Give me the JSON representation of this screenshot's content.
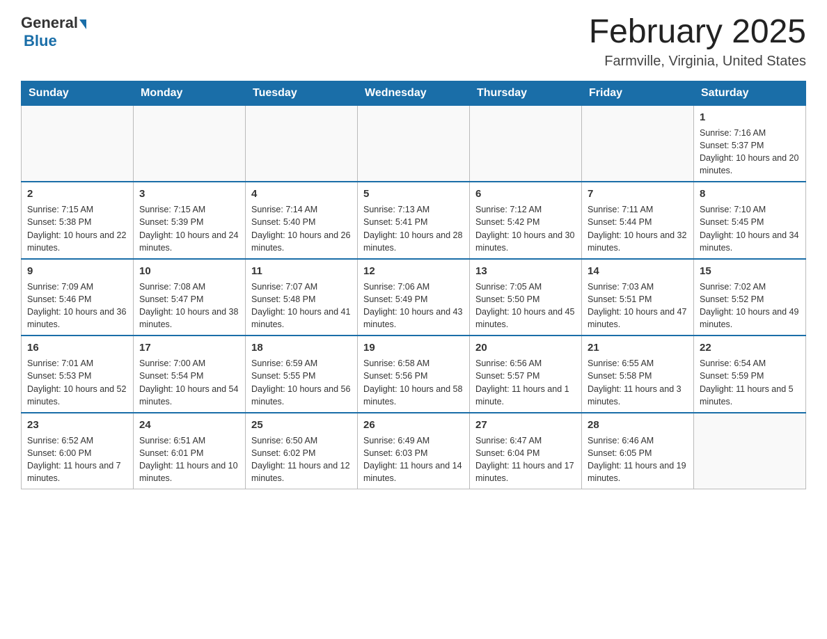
{
  "header": {
    "logo_general": "General",
    "logo_blue": "Blue",
    "month_title": "February 2025",
    "location": "Farmville, Virginia, United States"
  },
  "weekdays": [
    "Sunday",
    "Monday",
    "Tuesday",
    "Wednesday",
    "Thursday",
    "Friday",
    "Saturday"
  ],
  "weeks": [
    [
      {
        "day": "",
        "info": ""
      },
      {
        "day": "",
        "info": ""
      },
      {
        "day": "",
        "info": ""
      },
      {
        "day": "",
        "info": ""
      },
      {
        "day": "",
        "info": ""
      },
      {
        "day": "",
        "info": ""
      },
      {
        "day": "1",
        "info": "Sunrise: 7:16 AM\nSunset: 5:37 PM\nDaylight: 10 hours and 20 minutes."
      }
    ],
    [
      {
        "day": "2",
        "info": "Sunrise: 7:15 AM\nSunset: 5:38 PM\nDaylight: 10 hours and 22 minutes."
      },
      {
        "day": "3",
        "info": "Sunrise: 7:15 AM\nSunset: 5:39 PM\nDaylight: 10 hours and 24 minutes."
      },
      {
        "day": "4",
        "info": "Sunrise: 7:14 AM\nSunset: 5:40 PM\nDaylight: 10 hours and 26 minutes."
      },
      {
        "day": "5",
        "info": "Sunrise: 7:13 AM\nSunset: 5:41 PM\nDaylight: 10 hours and 28 minutes."
      },
      {
        "day": "6",
        "info": "Sunrise: 7:12 AM\nSunset: 5:42 PM\nDaylight: 10 hours and 30 minutes."
      },
      {
        "day": "7",
        "info": "Sunrise: 7:11 AM\nSunset: 5:44 PM\nDaylight: 10 hours and 32 minutes."
      },
      {
        "day": "8",
        "info": "Sunrise: 7:10 AM\nSunset: 5:45 PM\nDaylight: 10 hours and 34 minutes."
      }
    ],
    [
      {
        "day": "9",
        "info": "Sunrise: 7:09 AM\nSunset: 5:46 PM\nDaylight: 10 hours and 36 minutes."
      },
      {
        "day": "10",
        "info": "Sunrise: 7:08 AM\nSunset: 5:47 PM\nDaylight: 10 hours and 38 minutes."
      },
      {
        "day": "11",
        "info": "Sunrise: 7:07 AM\nSunset: 5:48 PM\nDaylight: 10 hours and 41 minutes."
      },
      {
        "day": "12",
        "info": "Sunrise: 7:06 AM\nSunset: 5:49 PM\nDaylight: 10 hours and 43 minutes."
      },
      {
        "day": "13",
        "info": "Sunrise: 7:05 AM\nSunset: 5:50 PM\nDaylight: 10 hours and 45 minutes."
      },
      {
        "day": "14",
        "info": "Sunrise: 7:03 AM\nSunset: 5:51 PM\nDaylight: 10 hours and 47 minutes."
      },
      {
        "day": "15",
        "info": "Sunrise: 7:02 AM\nSunset: 5:52 PM\nDaylight: 10 hours and 49 minutes."
      }
    ],
    [
      {
        "day": "16",
        "info": "Sunrise: 7:01 AM\nSunset: 5:53 PM\nDaylight: 10 hours and 52 minutes."
      },
      {
        "day": "17",
        "info": "Sunrise: 7:00 AM\nSunset: 5:54 PM\nDaylight: 10 hours and 54 minutes."
      },
      {
        "day": "18",
        "info": "Sunrise: 6:59 AM\nSunset: 5:55 PM\nDaylight: 10 hours and 56 minutes."
      },
      {
        "day": "19",
        "info": "Sunrise: 6:58 AM\nSunset: 5:56 PM\nDaylight: 10 hours and 58 minutes."
      },
      {
        "day": "20",
        "info": "Sunrise: 6:56 AM\nSunset: 5:57 PM\nDaylight: 11 hours and 1 minute."
      },
      {
        "day": "21",
        "info": "Sunrise: 6:55 AM\nSunset: 5:58 PM\nDaylight: 11 hours and 3 minutes."
      },
      {
        "day": "22",
        "info": "Sunrise: 6:54 AM\nSunset: 5:59 PM\nDaylight: 11 hours and 5 minutes."
      }
    ],
    [
      {
        "day": "23",
        "info": "Sunrise: 6:52 AM\nSunset: 6:00 PM\nDaylight: 11 hours and 7 minutes."
      },
      {
        "day": "24",
        "info": "Sunrise: 6:51 AM\nSunset: 6:01 PM\nDaylight: 11 hours and 10 minutes."
      },
      {
        "day": "25",
        "info": "Sunrise: 6:50 AM\nSunset: 6:02 PM\nDaylight: 11 hours and 12 minutes."
      },
      {
        "day": "26",
        "info": "Sunrise: 6:49 AM\nSunset: 6:03 PM\nDaylight: 11 hours and 14 minutes."
      },
      {
        "day": "27",
        "info": "Sunrise: 6:47 AM\nSunset: 6:04 PM\nDaylight: 11 hours and 17 minutes."
      },
      {
        "day": "28",
        "info": "Sunrise: 6:46 AM\nSunset: 6:05 PM\nDaylight: 11 hours and 19 minutes."
      },
      {
        "day": "",
        "info": ""
      }
    ]
  ]
}
